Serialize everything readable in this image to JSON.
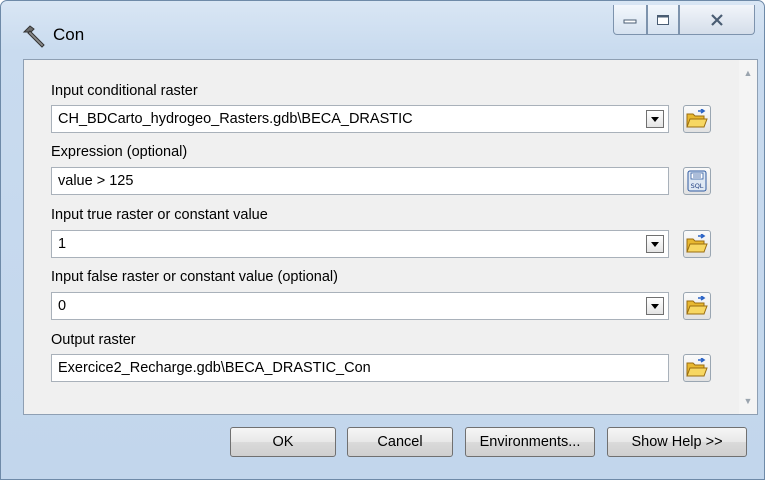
{
  "window": {
    "title": "Con"
  },
  "fields": [
    {
      "label": "Input conditional raster",
      "value": "CH_BDCarto_hydrogeo_Rasters.gdb\\BECA_DRASTIC"
    },
    {
      "label": "Expression (optional)",
      "value": "value > 125"
    },
    {
      "label": "Input true raster or constant value",
      "value": "1"
    },
    {
      "label": "Input false raster or constant value (optional)",
      "value": "0"
    },
    {
      "label": "Output raster",
      "value": "Exercice2_Recharge.gdb\\BECA_DRASTIC_Con"
    }
  ],
  "sql_button_label": "SQL",
  "buttons": {
    "ok": "OK",
    "cancel": "Cancel",
    "environments": "Environments...",
    "show_help": "Show Help >>"
  },
  "icons": {
    "title": "hammer-icon",
    "browse": "open-folder-icon",
    "sql": "sql-calculator-icon"
  }
}
